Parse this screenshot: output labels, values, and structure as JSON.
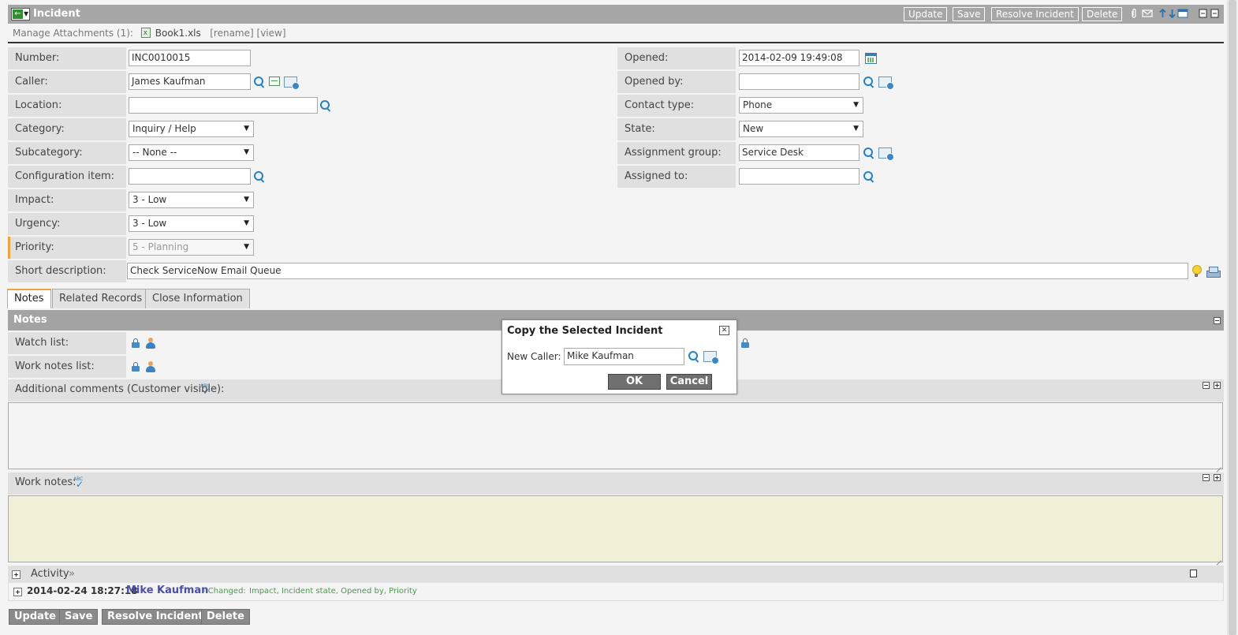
{
  "header": {
    "title": "Incident",
    "buttons": {
      "update": "Update",
      "save": "Save",
      "resolve": "Resolve Incident",
      "delete": "Delete"
    }
  },
  "attachments": {
    "label": "Manage Attachments (1):",
    "file": "Book1.xls",
    "rename": "[rename]",
    "view": "[view]"
  },
  "form": {
    "number": {
      "label": "Number:",
      "value": "INC0010015"
    },
    "caller": {
      "label": "Caller:",
      "value": "James Kaufman"
    },
    "location": {
      "label": "Location:",
      "value": ""
    },
    "category": {
      "label": "Category:",
      "value": "Inquiry / Help"
    },
    "subcategory": {
      "label": "Subcategory:",
      "value": "-- None --"
    },
    "config_item": {
      "label": "Configuration item:",
      "value": ""
    },
    "impact": {
      "label": "Impact:",
      "value": "3 - Low"
    },
    "urgency": {
      "label": "Urgency:",
      "value": "3 - Low"
    },
    "priority": {
      "label": "Priority:",
      "value": "5 - Planning"
    },
    "short_description": {
      "label": "Short description:",
      "value": "Check ServiceNow Email Queue"
    },
    "opened": {
      "label": "Opened:",
      "value": "2014-02-09 19:49:08"
    },
    "opened_by": {
      "label": "Opened by:",
      "value": ""
    },
    "contact_type": {
      "label": "Contact type:",
      "value": "Phone"
    },
    "state": {
      "label": "State:",
      "value": "New"
    },
    "assignment_group": {
      "label": "Assignment group:",
      "value": "Service Desk"
    },
    "assigned_to": {
      "label": "Assigned to:",
      "value": ""
    }
  },
  "tabs": [
    {
      "label": "Notes",
      "active": true
    },
    {
      "label": "Related Records",
      "active": false
    },
    {
      "label": "Close Information",
      "active": false
    }
  ],
  "notes": {
    "section_title": "Notes",
    "watch_list": "Watch list:",
    "work_notes_list": "Work notes list:",
    "additional_comments": "Additional comments (Customer visible):",
    "work_notes": "Work notes:",
    "spell_check_label": "ABC"
  },
  "activity": {
    "label": "Activity",
    "chevrons": "»",
    "timestamp": "2014-02-24 18:27:18",
    "user": "Mike Kaufman",
    "changed_label": "- Changed:",
    "changed_fields": "Impact, Incident state, Opened by, Priority"
  },
  "bottom_buttons": {
    "update": "Update",
    "save": "Save",
    "resolve": "Resolve Incident",
    "delete": "Delete"
  },
  "dialog": {
    "title": "Copy the Selected Incident",
    "close_glyph": "✕",
    "field_label": "New Caller:",
    "field_value": "Mike Kaufman",
    "ok": "OK",
    "cancel": "Cancel"
  },
  "colors": {
    "header_bg": "#a6a6a6",
    "label_bg": "#e0e0e0",
    "mandatory_accent": "#f0a33c",
    "work_notes_bg": "#f1efd6",
    "activity_user": "#4b4fa5",
    "activity_changed": "#4a9a4a"
  }
}
